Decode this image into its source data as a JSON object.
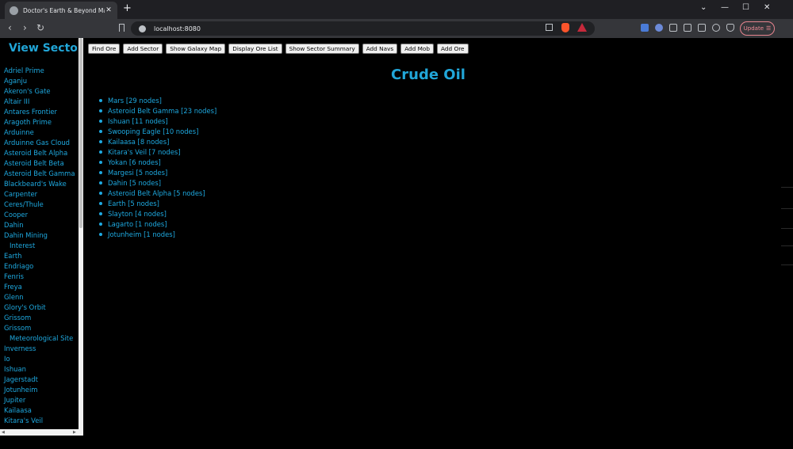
{
  "browser": {
    "tab_title": "Doctor's Earth & Beyond Map",
    "tab_close": "✕",
    "new_tab": "+",
    "url": "localhost:8080",
    "update_label": "Update",
    "window_controls": [
      "⌄",
      "—",
      "☐",
      "✕"
    ],
    "nav": [
      "‹",
      "›",
      "↻"
    ]
  },
  "sidebar": {
    "title": "View Sector",
    "sectors": [
      {
        "label": "Adriel Prime",
        "indent": false
      },
      {
        "label": "Aganju",
        "indent": false
      },
      {
        "label": "Akeron's Gate",
        "indent": false
      },
      {
        "label": "Altair III",
        "indent": false
      },
      {
        "label": "Antares Frontier",
        "indent": false
      },
      {
        "label": "Aragoth Prime",
        "indent": false
      },
      {
        "label": "Arduinne",
        "indent": false
      },
      {
        "label": "Arduinne Gas Cloud",
        "indent": false
      },
      {
        "label": "Asteroid Belt Alpha",
        "indent": false
      },
      {
        "label": "Asteroid Belt Beta",
        "indent": false
      },
      {
        "label": "Asteroid Belt Gamma",
        "indent": false
      },
      {
        "label": "Blackbeard's Wake",
        "indent": false
      },
      {
        "label": "Carpenter",
        "indent": false
      },
      {
        "label": "Ceres/Thule",
        "indent": false
      },
      {
        "label": "Cooper",
        "indent": false
      },
      {
        "label": "Dahin",
        "indent": false
      },
      {
        "label": "Dahin Mining",
        "indent": false
      },
      {
        "label": "Interest",
        "indent": true
      },
      {
        "label": "Earth",
        "indent": false
      },
      {
        "label": "Endriago",
        "indent": false
      },
      {
        "label": "Fenris",
        "indent": false
      },
      {
        "label": "Freya",
        "indent": false
      },
      {
        "label": "Glenn",
        "indent": false
      },
      {
        "label": "Glory's Orbit",
        "indent": false
      },
      {
        "label": "Grissom",
        "indent": false
      },
      {
        "label": "Grissom",
        "indent": false
      },
      {
        "label": "Meteorological Site",
        "indent": true
      },
      {
        "label": "Inverness",
        "indent": false
      },
      {
        "label": "Io",
        "indent": false
      },
      {
        "label": "Ishuan",
        "indent": false
      },
      {
        "label": "Jagerstadt",
        "indent": false
      },
      {
        "label": "Jotunheim",
        "indent": false
      },
      {
        "label": "Jupiter",
        "indent": false
      },
      {
        "label": "Kailaasa",
        "indent": false
      },
      {
        "label": "Kitara's Veil",
        "indent": false
      }
    ]
  },
  "toolbar_buttons": [
    "Find Ore",
    "Add Sector",
    "Show Galaxy Map",
    "Display Ore List",
    "Show Sector Summary",
    "Add Navs",
    "Add Mob",
    "Add Ore"
  ],
  "main": {
    "title": "Crude Oil",
    "ore_locations": [
      "Mars [29 nodes]",
      "Asteroid Belt Gamma [23 nodes]",
      "Ishuan [11 nodes]",
      "Swooping Eagle [10 nodes]",
      "Kailaasa [8 nodes]",
      "Kitara's Veil [7 nodes]",
      "Yokan [6 nodes]",
      "Margesi [5 nodes]",
      "Dahin [5 nodes]",
      "Asteroid Belt Alpha [5 nodes]",
      "Earth [5 nodes]",
      "Slayton [4 nodes]",
      "Lagarto [1 nodes]",
      "Jotunheim [1 nodes]"
    ]
  },
  "colors": {
    "accent": "#21a6d8",
    "link": "#1ea9e0",
    "background": "#000000"
  }
}
